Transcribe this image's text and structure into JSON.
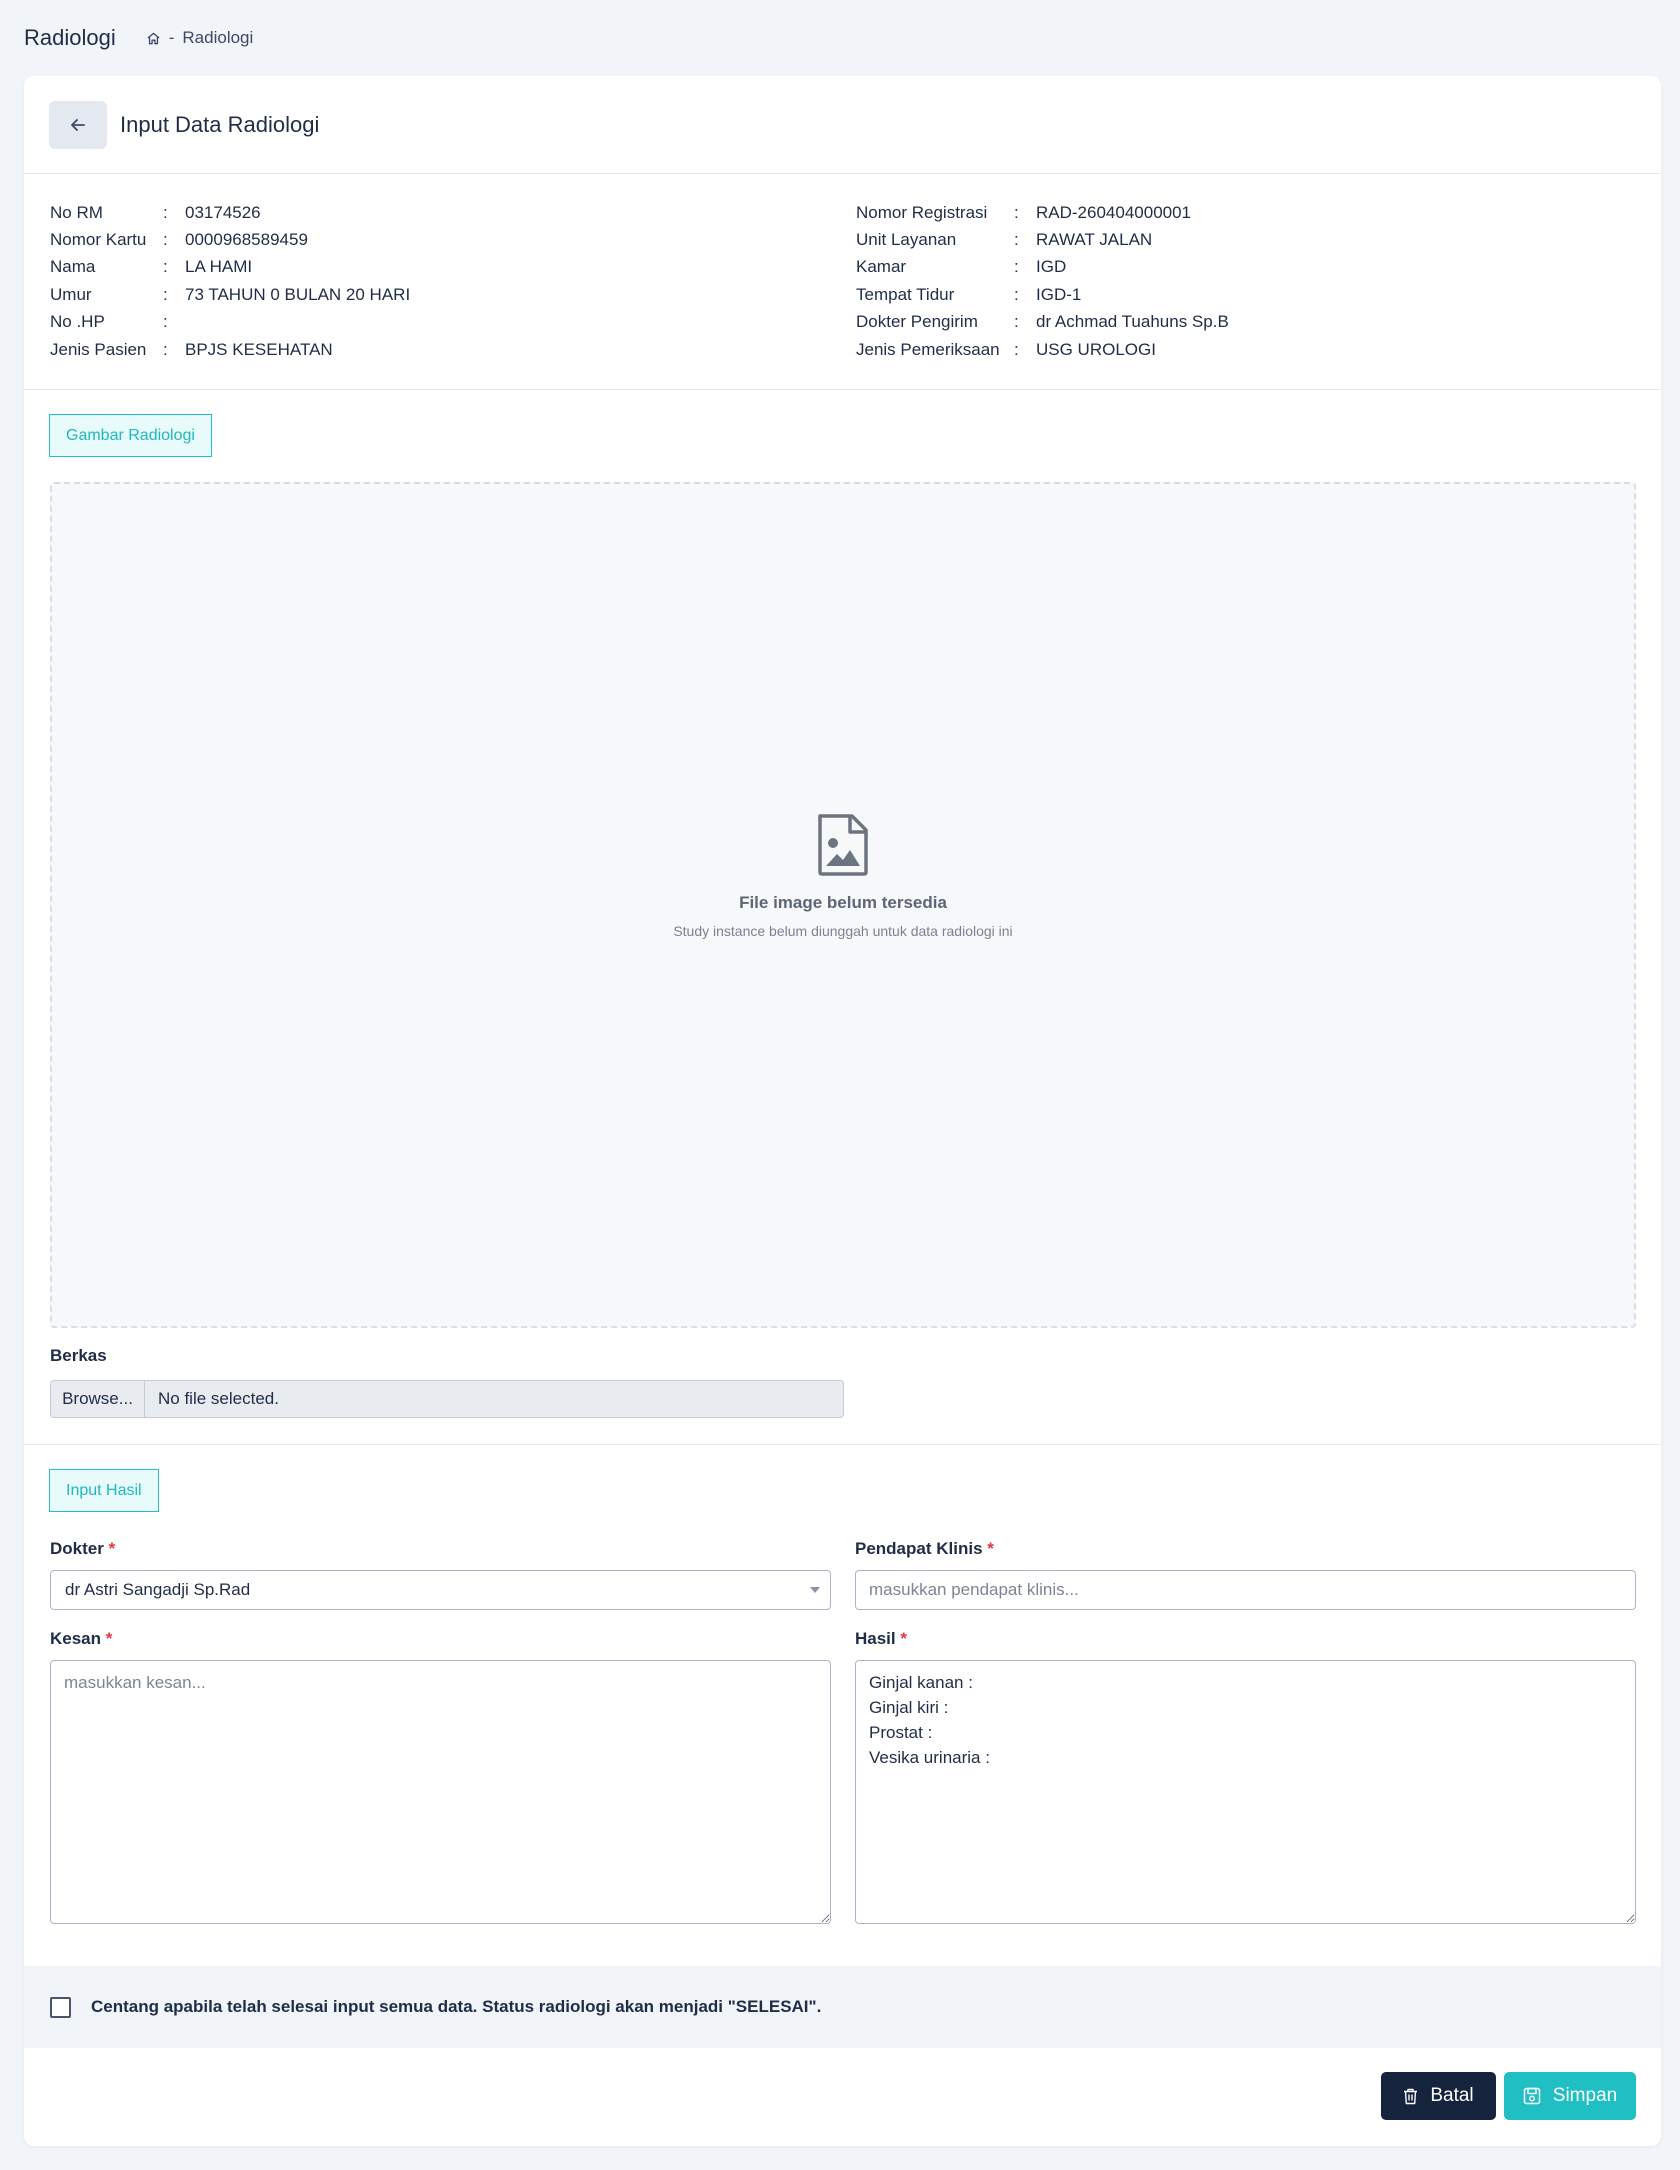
{
  "breadcrumb": {
    "page_title": "Radiologi",
    "separator": "-",
    "current": "Radiologi"
  },
  "header": {
    "title": "Input Data Radiologi"
  },
  "patient_left": [
    {
      "label": "No RM",
      "value": "03174526"
    },
    {
      "label": "Nomor Kartu",
      "value": "0000968589459"
    },
    {
      "label": "Nama",
      "value": "LA HAMI"
    },
    {
      "label": "Umur",
      "value": "73 TAHUN 0 BULAN 20 HARI"
    },
    {
      "label": "No .HP",
      "value": ""
    },
    {
      "label": "Jenis Pasien",
      "value": "BPJS KESEHATAN"
    }
  ],
  "patient_right": [
    {
      "label": "Nomor Registrasi",
      "value": "RAD-260404000001"
    },
    {
      "label": "Unit Layanan",
      "value": "RAWAT JALAN"
    },
    {
      "label": "Kamar",
      "value": "IGD"
    },
    {
      "label": "Tempat Tidur",
      "value": "IGD-1"
    },
    {
      "label": "Dokter Pengirim",
      "value": "dr Achmad Tuahuns Sp.B"
    },
    {
      "label": "Jenis Pemeriksaan",
      "value": "USG UROLOGI"
    }
  ],
  "colon": ":",
  "image_section": {
    "tag": "Gambar Radiologi",
    "empty_title": "File image belum tersedia",
    "empty_subtitle": "Study instance belum diunggah untuk data radiologi ini"
  },
  "file": {
    "label": "Berkas",
    "browse": "Browse...",
    "status": "No file selected."
  },
  "result_section": {
    "tag": "Input Hasil",
    "required_mark": "*",
    "dokter_label": "Dokter",
    "dokter_value": "dr Astri Sangadji Sp.Rad",
    "pendapat_label": "Pendapat Klinis",
    "pendapat_placeholder": "masukkan pendapat klinis...",
    "kesan_label": "Kesan",
    "kesan_placeholder": "masukkan kesan...",
    "hasil_label": "Hasil",
    "hasil_value": "Ginjal kanan :\nGinjal kiri :\nProstat :\nVesika urinaria :"
  },
  "confirm": {
    "text": "Centang apabila telah selesai input semua data. Status radiologi akan menjadi \"SELESAI\".",
    "checked": false
  },
  "buttons": {
    "cancel": "Batal",
    "save": "Simpan"
  },
  "colors": {
    "accent": "#1fbfc3",
    "dark": "#15233d",
    "background": "#f1f4f8"
  }
}
